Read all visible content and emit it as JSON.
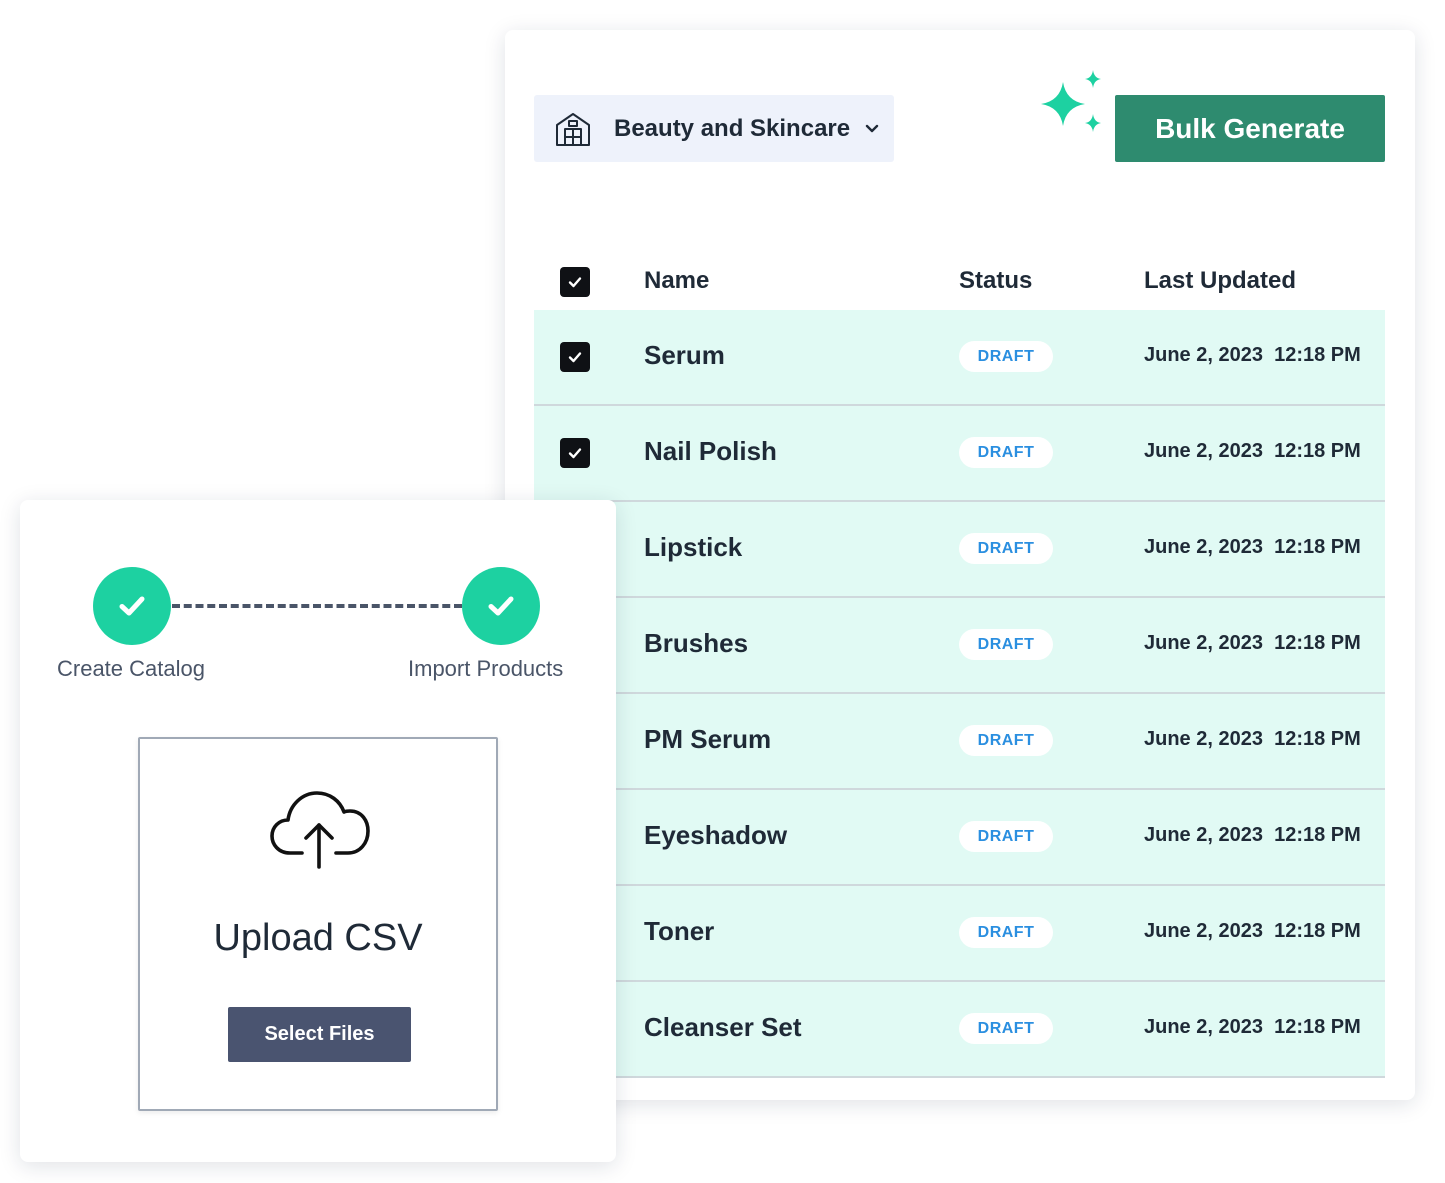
{
  "catalog": {
    "selected_catalog": "Beauty and Skincare",
    "bulk_generate_label": "Bulk Generate",
    "columns": {
      "name": "Name",
      "status": "Status",
      "last_updated": "Last Updated"
    },
    "rows": [
      {
        "name": "Serum",
        "status": "DRAFT",
        "updated": "June 2, 2023  12:18 PM",
        "checked": true
      },
      {
        "name": "Nail Polish",
        "status": "DRAFT",
        "updated": "June 2, 2023  12:18 PM",
        "checked": true
      },
      {
        "name": "Lipstick",
        "status": "DRAFT",
        "updated": "June 2, 2023  12:18 PM",
        "checked": true
      },
      {
        "name": "Brushes",
        "status": "DRAFT",
        "updated": "June 2, 2023  12:18 PM",
        "checked": true
      },
      {
        "name": "PM Serum",
        "status": "DRAFT",
        "updated": "June 2, 2023  12:18 PM",
        "checked": true
      },
      {
        "name": "Eyeshadow",
        "status": "DRAFT",
        "updated": "June 2, 2023  12:18 PM",
        "checked": true
      },
      {
        "name": "Toner",
        "status": "DRAFT",
        "updated": "June 2, 2023  12:18 PM",
        "checked": true
      },
      {
        "name": "Cleanser Set",
        "status": "DRAFT",
        "updated": "June 2, 2023  12:18 PM",
        "checked": true
      }
    ],
    "colors": {
      "accent": "#2e8b6f",
      "row_bg": "#e1faf4",
      "status_text": "#2b8fe0",
      "sparkle": "#1dd1a1"
    }
  },
  "upload": {
    "steps": [
      {
        "label": "Create Catalog",
        "complete": true
      },
      {
        "label": "Import Products",
        "complete": true
      }
    ],
    "title": "Upload CSV",
    "select_files_label": "Select Files",
    "colors": {
      "step_complete": "#1dd1a1",
      "button": "#4a5470"
    }
  }
}
